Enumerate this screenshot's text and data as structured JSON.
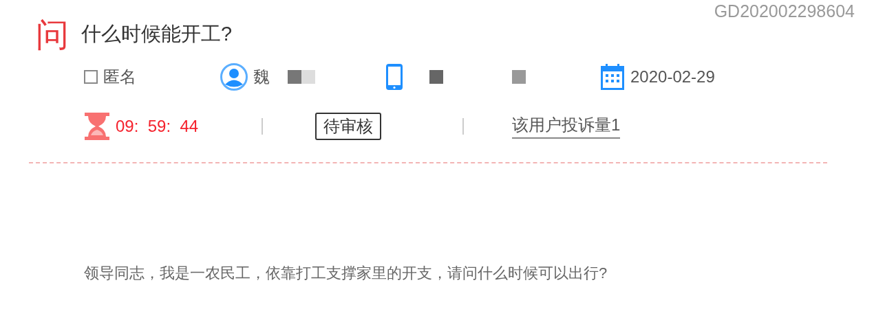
{
  "ticket_id": "GD202002298604",
  "question": {
    "badge": "问",
    "title": "什么时候能开工?"
  },
  "info": {
    "anonymous": {
      "label": "匿名",
      "checked": false
    },
    "user_name": "魏",
    "date": "2020-02-29"
  },
  "status_row": {
    "countdown": "09:  59:  44",
    "status": "待审核",
    "complaints_link": "该用户投诉量1"
  },
  "body": "领导同志，我是一农民工，依靠打工支撑家里的开支，请问什么时候可以出行?"
}
